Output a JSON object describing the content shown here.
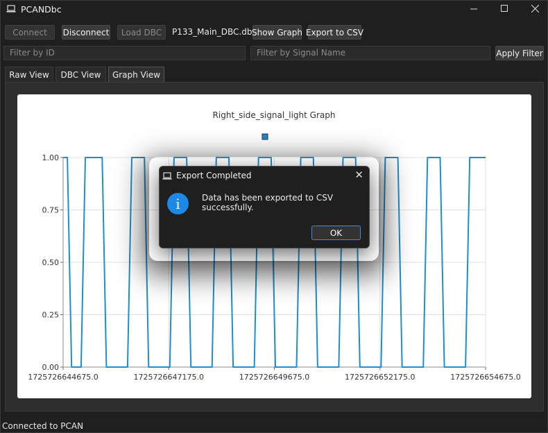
{
  "window": {
    "title": "PCANDbc",
    "min_icon": "minimize-icon",
    "max_icon": "maximize-icon",
    "close_icon": "close-icon"
  },
  "toolbar": {
    "connect_label": "Connect",
    "disconnect_label": "Disconnect",
    "load_dbc_label": "Load DBC",
    "dbc_file": "P133_Main_DBC.dbc",
    "show_graph_label": "Show Graph",
    "export_csv_label": "Export to CSV"
  },
  "filters": {
    "id_placeholder": "Filter by ID",
    "signal_placeholder": "Filter by Signal Name",
    "apply_label": "Apply Filter"
  },
  "tabs": [
    {
      "label": "Raw View",
      "active": false
    },
    {
      "label": "DBC View",
      "active": false
    },
    {
      "label": "Graph View",
      "active": true
    }
  ],
  "status": "Connected to PCAN",
  "colors": {
    "series": "#1f8ccb",
    "accent": "#1e88e5",
    "background": "#1f1f1f"
  },
  "chart_data": {
    "type": "line",
    "title": "Right_side_signal_light Graph",
    "xlabel": "",
    "ylabel": "",
    "ylim": [
      0,
      1
    ],
    "xlim": [
      1725726644675.0,
      1725726654675.0
    ],
    "y_ticks": [
      "0.00",
      "0.25",
      "0.50",
      "0.75",
      "1.00"
    ],
    "x_ticks": [
      "1725726644675.0",
      "1725726647175.0",
      "1725726649675.0",
      "1725726652175.0",
      "1725726654675.0"
    ],
    "legend": "top-center",
    "grid": true,
    "series": [
      {
        "name": "",
        "x": [
          1725726644675,
          1725726644775,
          1725726644875,
          1725726645100,
          1725726645200,
          1725726645300,
          1725726645600,
          1725726645700,
          1725726645800,
          1725726646100,
          1725726646200,
          1725726646300,
          1725726646600,
          1725726646700,
          1725726646800,
          1725726647100,
          1725726647200,
          1725726647300,
          1725726647600,
          1725726647700,
          1725726647800,
          1725726648100,
          1725726648200,
          1725726648300,
          1725726648600,
          1725726648700,
          1725726648800,
          1725726649100,
          1725726649200,
          1725726649300,
          1725726649600,
          1725726649700,
          1725726649800,
          1725726650100,
          1725726650200,
          1725726650300,
          1725726650600,
          1725726650700,
          1725726650800,
          1725726651100,
          1725726651200,
          1725726651300,
          1725726651600,
          1725726651700,
          1725726651800,
          1725726652100,
          1725726652200,
          1725726652300,
          1725726652600,
          1725726652700,
          1725726652800,
          1725726653100,
          1725726653200,
          1725726653300,
          1725726653600,
          1725726653700,
          1725726653800,
          1725726654100,
          1725726654200,
          1725726654300,
          1725726654675
        ],
        "y": [
          1,
          1,
          0,
          0,
          1,
          1,
          1,
          0,
          0,
          0,
          0,
          1,
          1,
          0,
          0,
          0,
          0,
          1,
          1,
          0,
          0,
          0,
          0,
          1,
          1,
          0,
          0,
          0,
          0,
          1,
          1,
          0,
          0,
          0,
          0,
          1,
          1,
          0,
          0,
          0,
          0,
          1,
          1,
          0,
          0,
          0,
          0,
          1,
          1,
          0,
          0,
          0,
          0,
          1,
          1,
          0,
          0,
          0,
          0,
          1,
          1
        ]
      }
    ]
  },
  "dialog": {
    "title": "Export Completed",
    "message": "Data has been exported to CSV successfully.",
    "ok_label": "OK",
    "info_glyph": "i"
  }
}
